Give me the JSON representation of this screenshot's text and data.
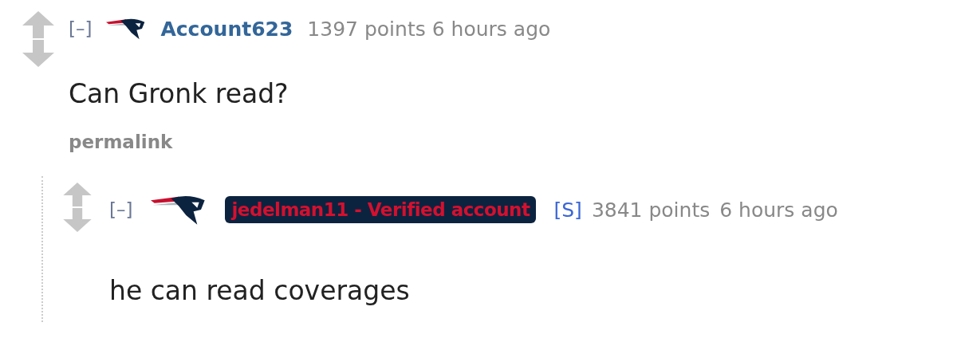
{
  "comments": [
    {
      "author": "Account623",
      "verified": false,
      "collapse": "[–]",
      "points": "1397 points",
      "time": "6 hours ago",
      "body": "Can Gronk read?",
      "links": [
        "permalink"
      ],
      "children": [
        {
          "author": "jedelman11 - Verified account",
          "verified": true,
          "submitter_tag": "[S]",
          "collapse": "[–]",
          "points": "3841 points",
          "time": "6 hours ago",
          "body": "he can read coverages"
        }
      ]
    }
  ]
}
